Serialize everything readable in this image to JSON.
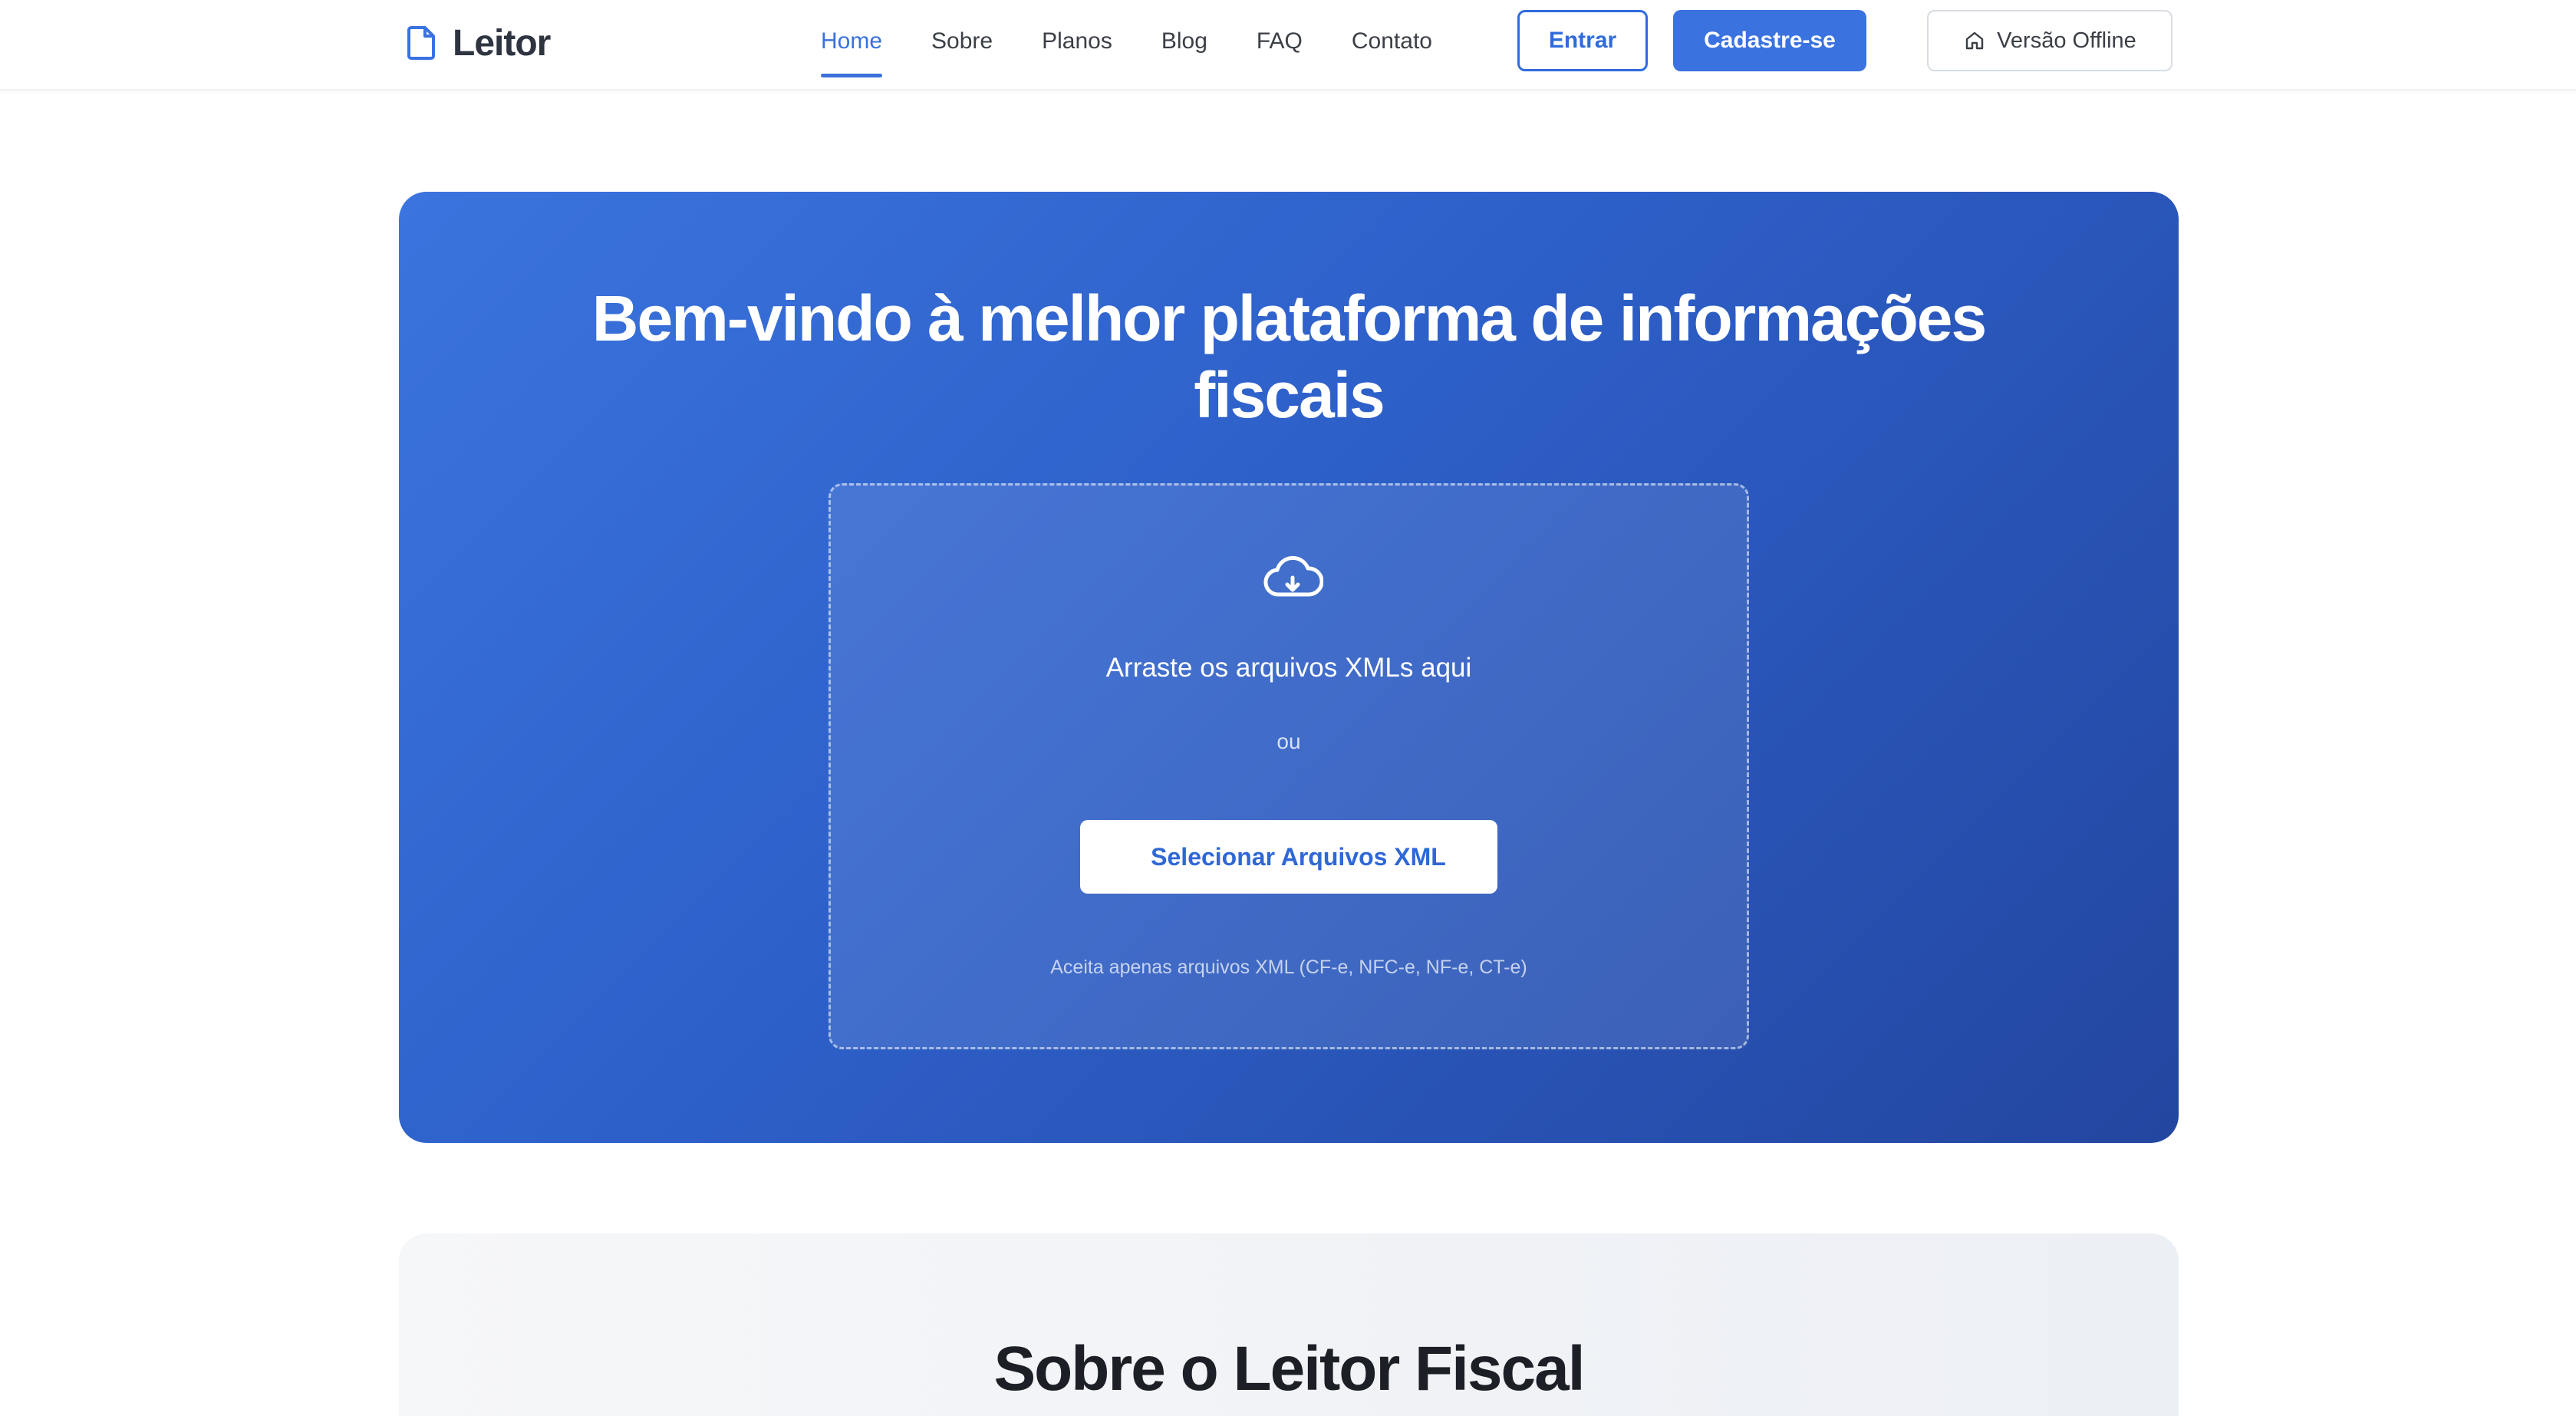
{
  "brand": {
    "name": "Leitor",
    "icon": "file-icon"
  },
  "nav": {
    "items": [
      {
        "label": "Home",
        "active": true
      },
      {
        "label": "Sobre"
      },
      {
        "label": "Planos"
      },
      {
        "label": "Blog"
      },
      {
        "label": "FAQ"
      },
      {
        "label": "Contato"
      }
    ],
    "login_label": "Entrar",
    "signup_label": "Cadastre-se",
    "offline_label": "Versão Offline",
    "offline_icon": "home-icon"
  },
  "hero": {
    "title": "Bem-vindo à melhor plataforma de informações fiscais",
    "upload_icon": "cloud-download-icon",
    "drop_text": "Arraste os arquivos XMLs aqui",
    "or_text": "ou",
    "select_button": "Selecionar Arquivos XML",
    "accept_text": "Aceita apenas arquivos XML (CF-e, NFC-e, NF-e, CT-e)"
  },
  "about": {
    "title": "Sobre o Leitor Fiscal"
  },
  "colors": {
    "primary": "#3a72e0",
    "hero_gradient_start": "#3b74de",
    "hero_gradient_end": "#2346a0",
    "text_dark": "#1c1f26"
  }
}
